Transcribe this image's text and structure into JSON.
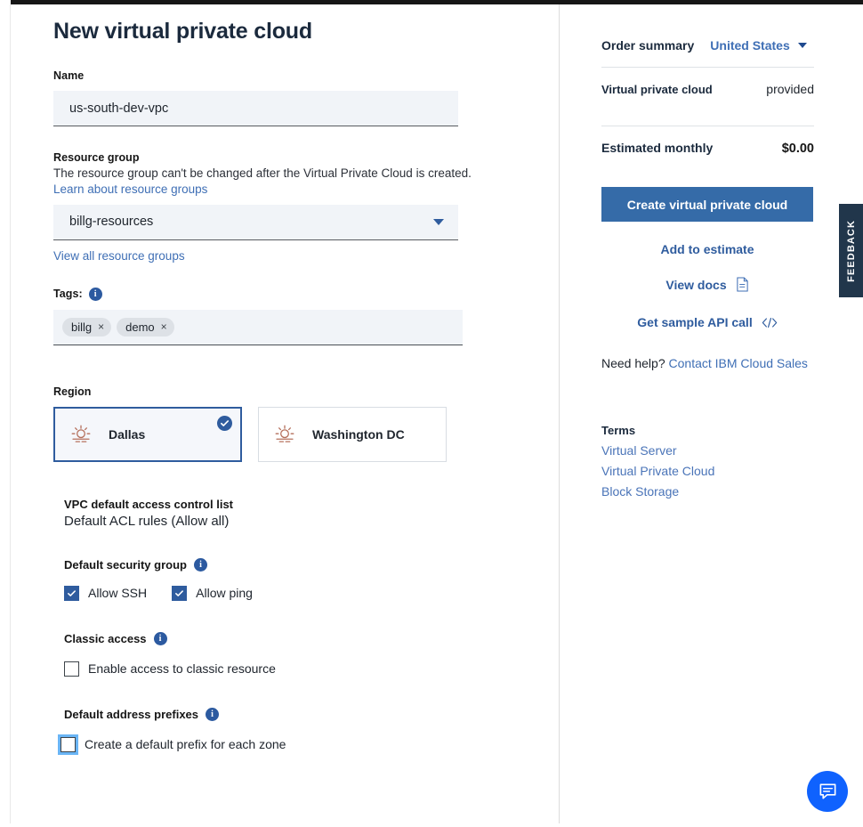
{
  "page": {
    "title": "New virtual private cloud"
  },
  "form": {
    "name": {
      "label": "Name",
      "value": "us-south-dev-vpc"
    },
    "resource_group": {
      "label": "Resource group",
      "helper": "The resource group can't be changed after the Virtual Private Cloud is created.",
      "learn_link": "Learn about resource groups",
      "selected": "billg-resources",
      "view_all_link": "View all resource groups"
    },
    "tags": {
      "label": "Tags:",
      "info_icon": "info-icon",
      "items": [
        {
          "label": "billg",
          "remove": "×"
        },
        {
          "label": "demo",
          "remove": "×"
        }
      ]
    },
    "region": {
      "label": "Region",
      "options": [
        {
          "name": "Dallas",
          "icon": "sunrise-icon",
          "selected": true
        },
        {
          "name": "Washington DC",
          "icon": "sunrise-icon",
          "selected": false
        }
      ]
    },
    "acl": {
      "heading": "VPC default access control list",
      "value": "Default ACL rules (Allow all)"
    },
    "security_group": {
      "heading": "Default security group",
      "info_icon": "info-icon",
      "checkboxes": [
        {
          "label": "Allow SSH",
          "checked": true
        },
        {
          "label": "Allow ping",
          "checked": true
        }
      ]
    },
    "classic_access": {
      "heading": "Classic access",
      "info_icon": "info-icon",
      "checkbox": {
        "label": "Enable access to classic resource",
        "checked": false
      }
    },
    "address_prefixes": {
      "heading": "Default address prefixes",
      "info_icon": "info-icon",
      "checkbox": {
        "label": "Create a default prefix for each zone",
        "checked": false,
        "focused": true
      }
    }
  },
  "summary": {
    "title": "Order summary",
    "country": "United States",
    "line_item": {
      "label": "Virtual private cloud",
      "value": "provided"
    },
    "total": {
      "label": "Estimated monthly",
      "value": "$0.00"
    },
    "create_button": "Create virtual private cloud",
    "add_to_estimate": "Add to estimate",
    "view_docs": "View docs",
    "view_docs_icon": "document-icon",
    "api_call": "Get sample API call",
    "api_call_icon": "code-icon",
    "need_help_prefix": "Need help?",
    "need_help_link": "Contact IBM Cloud Sales",
    "terms": {
      "title": "Terms",
      "links": [
        "Virtual Server",
        "Virtual Private Cloud",
        "Block Storage"
      ]
    }
  },
  "widgets": {
    "feedback_tab": "FEEDBACK",
    "chat_icon": "chat-bubble-icon"
  },
  "colors": {
    "accent_blue": "#2f5c9e",
    "button_blue": "#356ba8",
    "link_blue": "#3f6fb5",
    "chat_blue": "#0f62fe",
    "feedback_navy": "#21364b",
    "field_bg": "#f1f4f8",
    "sunrise": "#b5705c"
  }
}
